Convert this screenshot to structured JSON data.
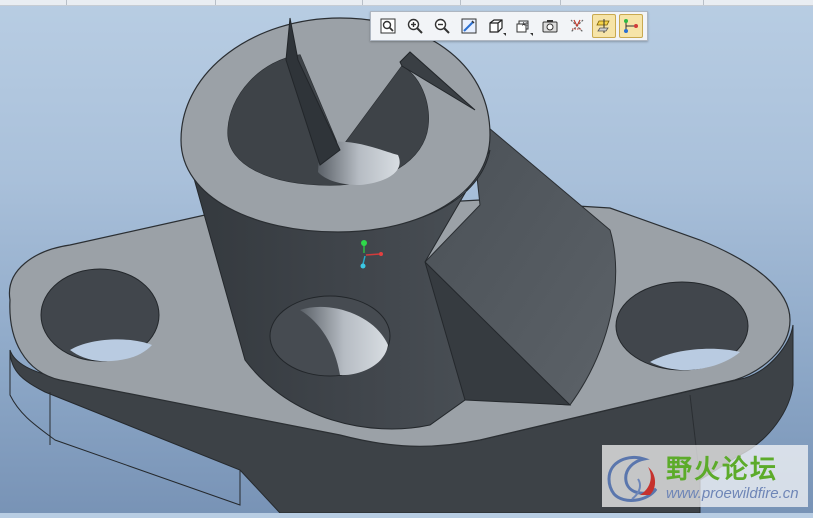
{
  "toolbar": {
    "buttons": [
      {
        "icon": "zoom-fit-icon",
        "active": false
      },
      {
        "icon": "zoom-in-icon",
        "active": false
      },
      {
        "icon": "zoom-out-icon",
        "active": false
      },
      {
        "icon": "repaint-icon",
        "active": false
      },
      {
        "icon": "shading-cube-icon",
        "active": false,
        "dropdown": true
      },
      {
        "icon": "saved-views-icon",
        "active": false,
        "dropdown": true
      },
      {
        "icon": "view-manager-icon",
        "active": false
      },
      {
        "icon": "datum-planes-icon",
        "active": false
      },
      {
        "icon": "datum-axes-icon",
        "active": true
      },
      {
        "icon": "datum-points-icon",
        "active": true
      }
    ]
  },
  "watermark": {
    "title": "野火论坛",
    "url": "www.proewildfire.cn"
  },
  "colors": {
    "background_top": "#b8cde3",
    "background_bottom": "#7893b6",
    "model_face": "#9aa0a6",
    "model_side": "#3f4449",
    "active_button": "#f6e4a8"
  }
}
